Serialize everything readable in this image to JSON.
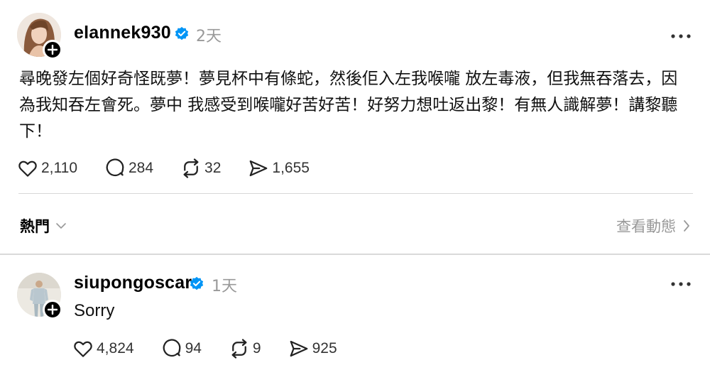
{
  "post1": {
    "username": "elannek930",
    "time": "2天",
    "text": "尋晚發左個好奇怪既夢！夢見杯中有條蛇，然後佢入左我喉嚨 放左毒液，但我無吞落去，因為我知吞左會死。夢中 我感受到喉嚨好苦好苦！好努力想吐返出黎！有無人識解夢！講黎聽下！",
    "likes": "2,110",
    "comments": "284",
    "reposts": "32",
    "shares": "1,655"
  },
  "section": {
    "hot_label": "熱門",
    "view_activity_label": "查看動態"
  },
  "post2": {
    "username": "siupongoscar",
    "time": "1天",
    "text": "Sorry",
    "likes": "4,824",
    "comments": "94",
    "reposts": "9",
    "shares": "925"
  },
  "colors": {
    "verified": "#0095f6",
    "muted": "#999999",
    "divider": "#d8d8d8"
  },
  "icons": [
    "plus-icon",
    "verified-badge-icon",
    "more-icon",
    "heart-icon",
    "comment-icon",
    "repost-icon",
    "share-icon",
    "chevron-down-icon",
    "chevron-right-icon"
  ]
}
